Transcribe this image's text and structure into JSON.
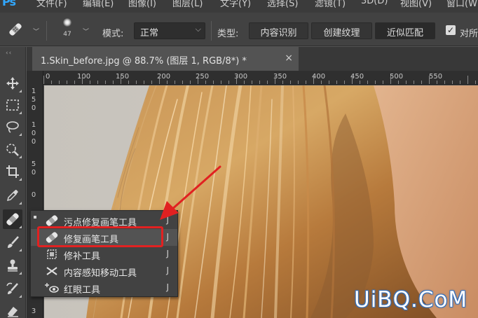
{
  "menubar": {
    "logo": "Ps",
    "items": [
      "文件(F)",
      "编辑(E)",
      "图像(I)",
      "图层(L)",
      "文字(Y)",
      "选择(S)",
      "滤镜(T)",
      "3D(D)",
      "视图(V)",
      "窗口(W)"
    ]
  },
  "options": {
    "brush_size": "47",
    "mode_label": "模式:",
    "mode_value": "正常",
    "type_label": "类型:",
    "type_options": [
      "内容识别",
      "创建纹理",
      "近似匹配"
    ],
    "type_selected": "近似匹配",
    "sample_all_label": "对所",
    "sample_all_checked": true
  },
  "document": {
    "tab_title": "1.Skin_before.jpg @ 88.7% (图层 1, RGB/8*) *",
    "close": "×"
  },
  "ruler": {
    "top_labels": [
      "0",
      "100",
      "150",
      "200",
      "250",
      "300",
      "350",
      "400",
      "450",
      "500",
      "550"
    ],
    "left_labels": [
      "1\n5\n0",
      "1\n0\n0",
      "5\n0",
      "0",
      "5",
      "3"
    ]
  },
  "tools": [
    {
      "name": "move-tool",
      "icon": "move-icon"
    },
    {
      "name": "marquee-tool",
      "icon": "marquee-icon"
    },
    {
      "name": "lasso-tool",
      "icon": "lasso-icon"
    },
    {
      "name": "quick-select-tool",
      "icon": "quick-select-icon"
    },
    {
      "name": "crop-tool",
      "icon": "crop-icon"
    },
    {
      "name": "eyedropper-tool",
      "icon": "eyedropper-icon"
    },
    {
      "name": "healing-brush-tool",
      "icon": "bandage-icon"
    },
    {
      "name": "brush-tool",
      "icon": "brush-icon"
    },
    {
      "name": "stamp-tool",
      "icon": "stamp-icon"
    },
    {
      "name": "history-brush-tool",
      "icon": "history-brush-icon"
    },
    {
      "name": "eraser-tool",
      "icon": "eraser-icon"
    }
  ],
  "flyout": {
    "items": [
      {
        "label": "污点修复画笔工具",
        "key": "J",
        "icon": "spot-healing-icon",
        "current": true
      },
      {
        "label": "修复画笔工具",
        "key": "J",
        "icon": "healing-brush-icon",
        "highlighted": true
      },
      {
        "label": "修补工具",
        "key": "J",
        "icon": "patch-icon"
      },
      {
        "label": "内容感知移动工具",
        "key": "J",
        "icon": "content-aware-move-icon"
      },
      {
        "label": "红眼工具",
        "key": "J",
        "icon": "red-eye-icon"
      }
    ],
    "highlight_color": "#e12121"
  },
  "watermark": "UiBQ.CoM"
}
